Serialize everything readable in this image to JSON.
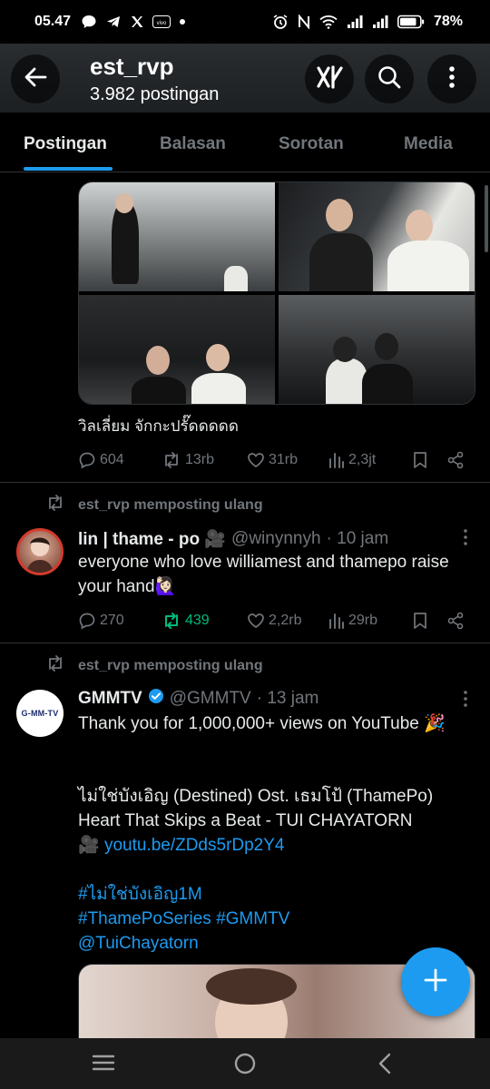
{
  "status_bar": {
    "time": "05.47",
    "battery": "78%",
    "notification_icons": [
      "chat-bubble-icon",
      "telegram-icon",
      "x-icon",
      "vivo-icon",
      "dot-icon"
    ],
    "system_icons": [
      "alarm-icon",
      "nfc-icon",
      "wifi-icon",
      "signal-icon",
      "signal-icon",
      "battery-icon"
    ]
  },
  "header": {
    "title": "est_rvp",
    "subtitle": "3.982 postingan"
  },
  "tabs": [
    {
      "label": "Postingan",
      "active": true
    },
    {
      "label": "Balasan",
      "active": false
    },
    {
      "label": "Sorotan",
      "active": false
    },
    {
      "label": "Media",
      "active": false
    }
  ],
  "tweet1": {
    "caption": "วิลเลี่ยม จักกะปรั๊ดดดดด",
    "replies": "604",
    "reposts": "13rb",
    "likes": "31rb",
    "views": "2,3jt"
  },
  "tweet2": {
    "repost_label": "est_rvp memposting ulang",
    "name": "lin | thame - po 🎥",
    "handle": "@winynnyh",
    "time": "· 10 jam",
    "text": "everyone who love williamest and thamepo raise your hand🙋🏻‍♀️",
    "replies": "270",
    "reposts": "439",
    "likes": "2,2rb",
    "views": "29rb",
    "repost_active_color": "#00ba7c"
  },
  "tweet3": {
    "repost_label": "est_rvp memposting ulang",
    "name": "GMMTV",
    "handle": "@GMMTV",
    "time": "· 13 jam",
    "line1": "Thank you for 1,000,000+ views on YouTube 🎉",
    "line2": "ไม่ใช่บังเอิญ (Destined) Ost. เธมโป้ (ThamePo)",
    "line3": "Heart That Skips a Beat - TUI CHAYATORN",
    "link_prefix": "🎥 ",
    "link": "youtu.be/ZDds5rDp2Y4",
    "hashtag1": "#ไม่ใช่บังเอิญ1M",
    "hashtag2": "#ThamePoSeries #GMMTV",
    "mention": "@TuiChayatorn",
    "avatar_text": "G-MM-TV"
  },
  "colors": {
    "accent": "#1d9bf0",
    "muted": "#71767b",
    "text": "#e7e9ea",
    "background": "#000000"
  }
}
